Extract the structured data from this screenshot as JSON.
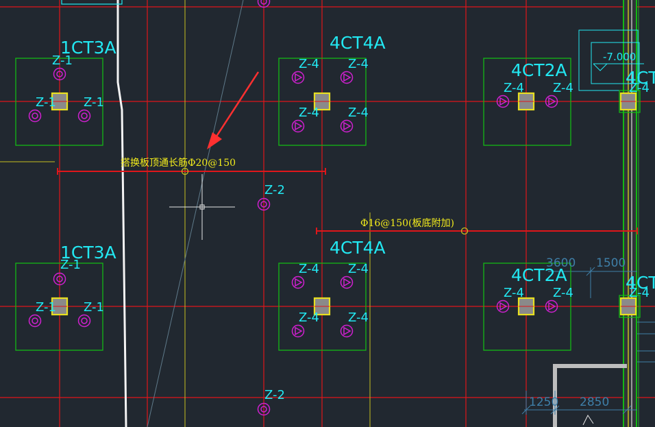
{
  "drawing": {
    "background": "#212830",
    "colors": {
      "grid": "#e0161a",
      "column": "#e8e020",
      "pile": "#d020d0",
      "cap_outline": "#14b814",
      "text_cyan": "#22e8f2",
      "text_yellow": "#f2ec1c",
      "dimension": "#3f7fa8",
      "wall": "#bdbdbd",
      "annotation_arrow": "#ff3030"
    },
    "caps": [
      {
        "name": "1CT3A",
        "piles": [
          "Z-1",
          "Z-1",
          "Z-1"
        ]
      },
      {
        "name": "4CT4A",
        "piles": [
          "Z-4",
          "Z-4",
          "Z-4",
          "Z-4"
        ]
      },
      {
        "name": "4CT2A",
        "piles": [
          "Z-4",
          "Z-4"
        ]
      },
      {
        "name": "4CT",
        "piles": [
          "Z-4"
        ]
      },
      {
        "name": "1CT3A",
        "piles": [
          "Z-1",
          "Z-1",
          "Z-1"
        ]
      },
      {
        "name": "4CT4A",
        "piles": [
          "Z-4",
          "Z-4",
          "Z-4",
          "Z-4"
        ]
      },
      {
        "name": "4CT2A",
        "piles": [
          "Z-4",
          "Z-4"
        ]
      },
      {
        "name": "4CT",
        "piles": [
          "Z-4"
        ]
      }
    ],
    "single_piles": [
      "Z-2",
      "Z-2"
    ],
    "rebar_notes": {
      "top_through": "搭换板顶通长筋Φ20@150",
      "bottom_additional": "Φ16@150(板底附加)"
    },
    "elevation": "-7.000",
    "dimensions": [
      "3600",
      "1500",
      "1250",
      "2850"
    ],
    "cursor": "crosshair"
  }
}
